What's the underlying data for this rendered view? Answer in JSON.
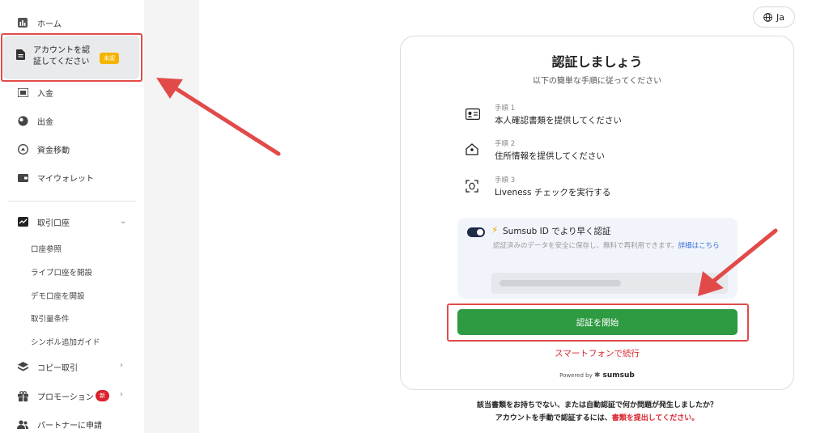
{
  "sidebar": {
    "home": "ホーム",
    "verify_account": "アカウントを認証してください",
    "verify_badge": "未認",
    "deposit": "入金",
    "withdraw": "出金",
    "transfer": "資金移動",
    "wallet": "マイウォレット",
    "trading_accounts": "取引口座",
    "sub_items": [
      "口座参照",
      "ライブ口座を開設",
      "デモ口座を開設",
      "取引量条件",
      "シンボル追加ガイド"
    ],
    "copy_trading": "コピー取引",
    "promotions": "プロモーション",
    "promotions_badge": "新",
    "partner": "パートナーに申請"
  },
  "header": {
    "language": "Ja"
  },
  "card": {
    "title": "認証しましょう",
    "subtitle": "以下の簡単な手順に従ってください",
    "steps": [
      {
        "num": "手順 1",
        "text": "本人確認書類を提供してください",
        "icon": "id-card-icon"
      },
      {
        "num": "手順 2",
        "text": "住所情報を提供してください",
        "icon": "home-icon"
      },
      {
        "num": "手順 3",
        "text": "Liveness チェックを実行する",
        "icon": "face-scan-icon"
      }
    ],
    "sumsub": {
      "title": "Sumsub ID でより早く認証",
      "desc": "認証済みのデータを安全に保存し、無料で再利用できます。",
      "link": "詳細はこちら"
    },
    "start_button": "認証を開始",
    "phone_link": "スマートフォンで続行",
    "powered_prefix": "Powered by",
    "powered_brand": "sumsub"
  },
  "footer": {
    "question": "該当書類をお持ちでない、または自動認証で何か問題が発生しましたか？",
    "answer_prefix": "アカウントを手動で認証するには、",
    "answer_link": "書類を提出してください。"
  },
  "colors": {
    "accent_green": "#2e9a41",
    "highlight_red": "#e24a4a",
    "badge_yellow": "#f5b400",
    "link_red": "#d9232d"
  }
}
